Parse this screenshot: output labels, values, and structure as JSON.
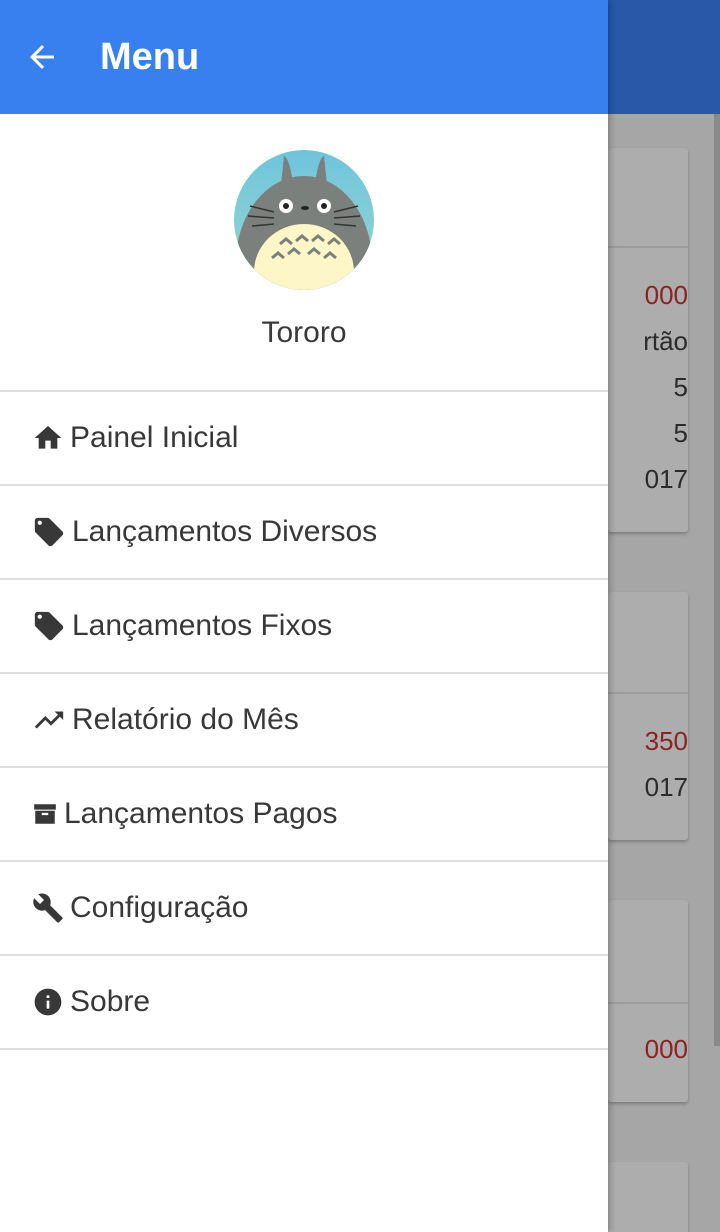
{
  "drawer": {
    "title": "Menu",
    "user": {
      "name": "Tororo"
    },
    "items": [
      {
        "label": "Painel Inicial",
        "icon": "home-icon"
      },
      {
        "label": "Lançamentos Diversos",
        "icon": "tag-icon"
      },
      {
        "label": "Lançamentos Fixos",
        "icon": "tag-icon"
      },
      {
        "label": "Relatório do Mês",
        "icon": "trending-up-icon"
      },
      {
        "label": "Lançamentos Pagos",
        "icon": "archive-icon"
      },
      {
        "label": "Configuração",
        "icon": "wrench-icon"
      },
      {
        "label": "Sobre",
        "icon": "info-icon"
      }
    ]
  },
  "background": {
    "card1": [
      "000",
      "rtão",
      "5",
      "5",
      "017"
    ],
    "card2": [
      "350",
      "017"
    ],
    "card3": [
      "000"
    ]
  },
  "colors": {
    "primary": "#3880f0",
    "accent_red": "#c62828"
  }
}
